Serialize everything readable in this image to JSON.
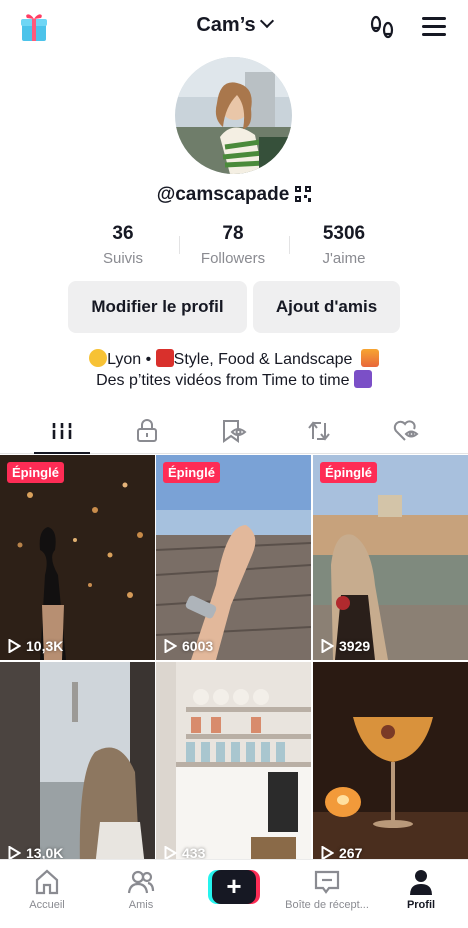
{
  "header": {
    "account_name": "Cam’s",
    "icons": {
      "left": "gift-icon",
      "right1": "footprints-icon",
      "right2": "hamburger-menu-icon"
    }
  },
  "profile": {
    "username": "@camscapade",
    "stats": [
      {
        "value": "36",
        "label": "Suivis"
      },
      {
        "value": "78",
        "label": "Followers"
      },
      {
        "value": "5306",
        "label": "J'aime"
      }
    ],
    "buttons": {
      "edit": "Modifier le profil",
      "add_friends": "Ajout d'amis"
    },
    "bio_line1_a": "Lyon • ",
    "bio_line1_b": "Style, Food & Landscape",
    "bio_line2": "Des p’tites vidéos from Time to time"
  },
  "tabs": [
    "videos-grid-icon",
    "lock-icon",
    "saved-eye-icon",
    "repost-icon",
    "liked-heart-icon"
  ],
  "videos": [
    {
      "pinned": "Épinglé",
      "views": "10,3K"
    },
    {
      "pinned": "Épinglé",
      "views": "6003"
    },
    {
      "pinned": "Épinglé",
      "views": "3929"
    },
    {
      "pinned": "",
      "views": "13,0K"
    },
    {
      "pinned": "",
      "views": "433"
    },
    {
      "pinned": "",
      "views": "267"
    }
  ],
  "nav": [
    {
      "label": "Accueil"
    },
    {
      "label": "Amis"
    },
    {
      "label": ""
    },
    {
      "label": "Boîte de récept..."
    },
    {
      "label": "Profil"
    }
  ],
  "colors": {
    "accent": "#fe2c55",
    "cyan": "#25f4ee",
    "text": "#161823",
    "muted": "#8a8b91"
  }
}
